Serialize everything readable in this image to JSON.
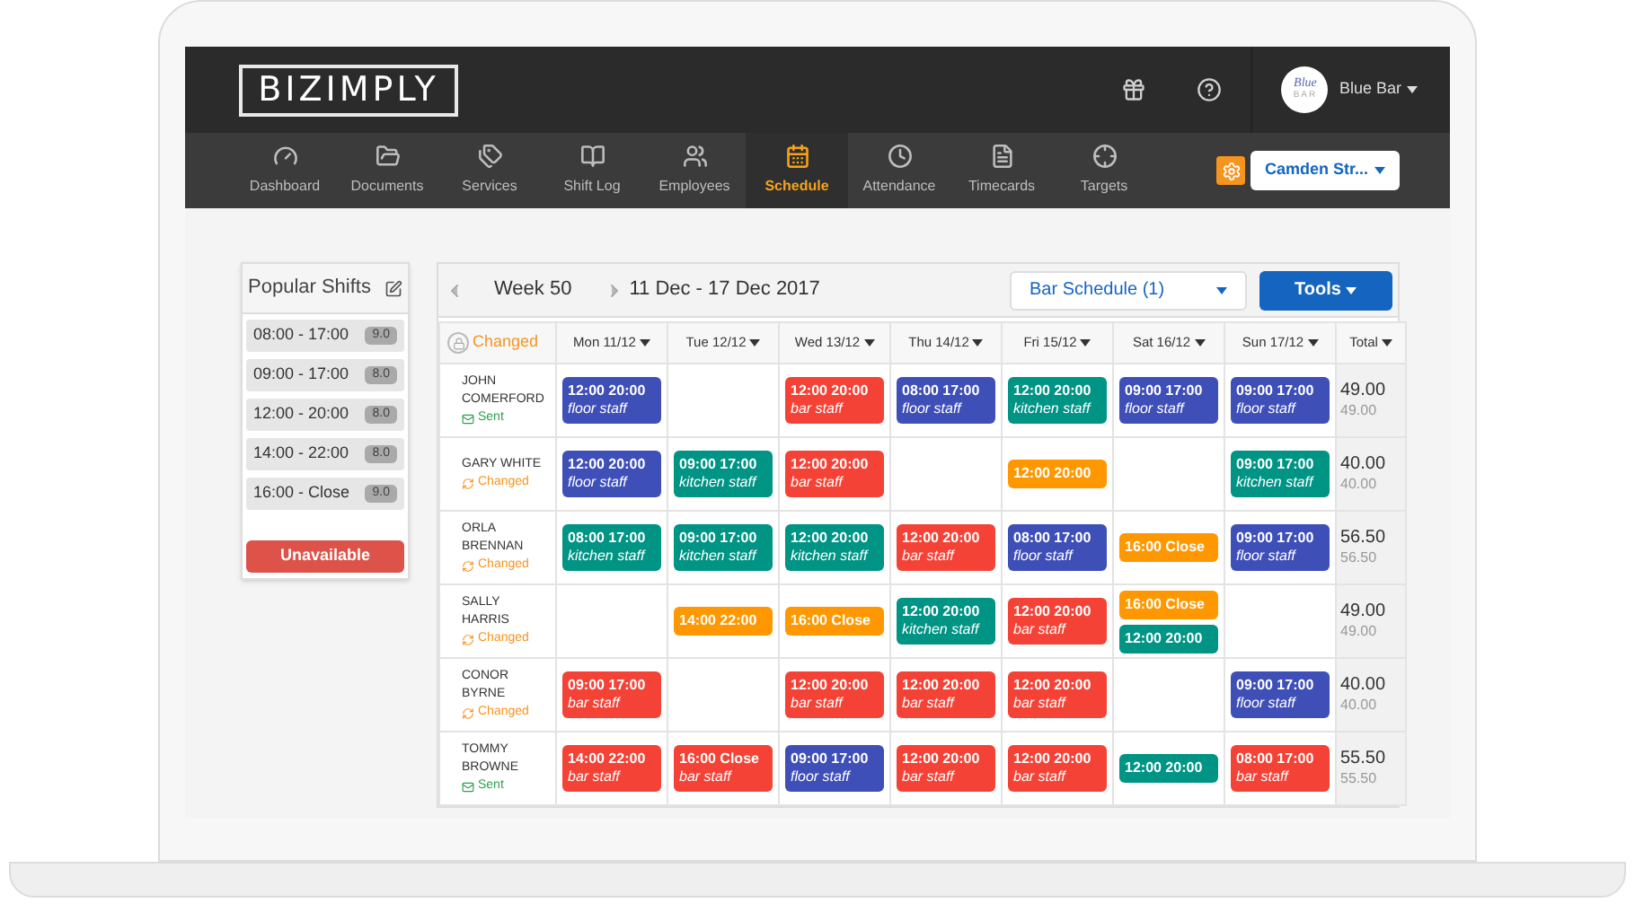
{
  "header": {
    "logo": "BIZIMPLY",
    "avatar_lines": [
      "Blue",
      "BAR"
    ],
    "account": "Blue Bar"
  },
  "nav": [
    {
      "label": "Dashboard",
      "selected": false
    },
    {
      "label": "Documents",
      "selected": false
    },
    {
      "label": "Services",
      "selected": false
    },
    {
      "label": "Shift Log",
      "selected": false
    },
    {
      "label": "Employees",
      "selected": false
    },
    {
      "label": "Schedule",
      "selected": true
    },
    {
      "label": "Attendance",
      "selected": false
    },
    {
      "label": "Timecards",
      "selected": false
    },
    {
      "label": "Targets",
      "selected": false
    }
  ],
  "location": "Camden Str...",
  "popular_shifts": {
    "title": "Popular Shifts",
    "items": [
      {
        "time": "08:00 - 17:00",
        "hours": "9.0"
      },
      {
        "time": "09:00 - 17:00",
        "hours": "8.0"
      },
      {
        "time": "12:00 - 20:00",
        "hours": "8.0"
      },
      {
        "time": "14:00 - 22:00",
        "hours": "8.0"
      },
      {
        "time": "16:00 - Close",
        "hours": "9.0"
      }
    ],
    "unavailable": "Unavailable"
  },
  "toolbar": {
    "week": "Week 50",
    "range": "11 Dec - 17 Dec 2017",
    "schedule": "Bar Schedule (1)",
    "tools": "Tools"
  },
  "table": {
    "status": "Changed",
    "columns": [
      "Mon 11/12",
      "Tue 12/12",
      "Wed 13/12",
      "Thu 14/12",
      "Fri 15/12",
      "Sat 16/12",
      "Sun 17/12",
      "Total"
    ],
    "rows": [
      {
        "name": "JOHN COMERFORD",
        "state": {
          "kind": "sent",
          "text": "Sent"
        },
        "days": [
          {
            "kind": "shifts",
            "shifts": [
              {
                "time": "12:00 20:00",
                "role": "floor staff",
                "color": "#3f4fb8"
              }
            ]
          },
          {
            "kind": "off"
          },
          {
            "kind": "shifts",
            "shifts": [
              {
                "time": "12:00 20:00",
                "role": "bar staff",
                "color": "#f44336"
              }
            ]
          },
          {
            "kind": "shifts",
            "shifts": [
              {
                "time": "08:00 17:00",
                "role": "floor staff",
                "color": "#3f4fb8"
              }
            ]
          },
          {
            "kind": "shifts",
            "shifts": [
              {
                "time": "12:00 20:00",
                "role": "kitchen staff",
                "color": "#009485"
              }
            ]
          },
          {
            "kind": "shifts",
            "shifts": [
              {
                "time": "09:00 17:00",
                "role": "floor staff",
                "color": "#3f4fb8"
              }
            ]
          },
          {
            "kind": "shifts",
            "shifts": [
              {
                "time": "09:00 17:00",
                "role": "floor staff",
                "color": "#3f4fb8"
              }
            ]
          }
        ],
        "total": "49.00",
        "subtotal": "49.00"
      },
      {
        "name": "GARY WHITE",
        "state": {
          "kind": "changed",
          "text": "Changed"
        },
        "days": [
          {
            "kind": "shifts",
            "shifts": [
              {
                "time": "12:00 20:00",
                "role": "floor staff",
                "color": "#3f4fb8"
              }
            ]
          },
          {
            "kind": "shifts",
            "shifts": [
              {
                "time": "09:00 17:00",
                "role": "kitchen staff",
                "color": "#009485"
              }
            ]
          },
          {
            "kind": "shifts",
            "shifts": [
              {
                "time": "12:00 20:00",
                "role": "bar staff",
                "color": "#f44336"
              }
            ]
          },
          {
            "kind": "off"
          },
          {
            "kind": "shifts",
            "shifts": [
              {
                "time": "12:00 20:00",
                "color": "#ff9800"
              }
            ]
          },
          {
            "kind": "off"
          },
          {
            "kind": "shifts",
            "shifts": [
              {
                "time": "09:00 17:00",
                "role": "kitchen staff",
                "color": "#009485"
              }
            ]
          }
        ],
        "total": "40.00",
        "subtotal": "40.00"
      },
      {
        "name": "ORLA BRENNAN",
        "state": {
          "kind": "changed",
          "text": "Changed"
        },
        "days": [
          {
            "kind": "shifts",
            "shifts": [
              {
                "time": "08:00 17:00",
                "role": "kitchen staff",
                "color": "#009485"
              }
            ]
          },
          {
            "kind": "shifts",
            "shifts": [
              {
                "time": "09:00 17:00",
                "role": "kitchen staff",
                "color": "#009485"
              }
            ]
          },
          {
            "kind": "shifts",
            "shifts": [
              {
                "time": "12:00 20:00",
                "role": "kitchen staff",
                "color": "#009485"
              }
            ]
          },
          {
            "kind": "shifts",
            "shifts": [
              {
                "time": "12:00 20:00",
                "role": "bar staff",
                "color": "#f44336"
              }
            ]
          },
          {
            "kind": "shifts",
            "shifts": [
              {
                "time": "08:00 17:00",
                "role": "floor staff",
                "color": "#3f4fb8"
              }
            ]
          },
          {
            "kind": "shifts",
            "shifts": [
              {
                "time": "16:00 Close",
                "color": "#ff9800"
              }
            ]
          },
          {
            "kind": "shifts",
            "shifts": [
              {
                "time": "09:00 17:00",
                "role": "floor staff",
                "color": "#3f4fb8"
              }
            ]
          }
        ],
        "total": "56.50",
        "subtotal": "56.50"
      },
      {
        "name": "SALLY HARRIS",
        "state": {
          "kind": "changed",
          "text": "Changed"
        },
        "days": [
          {
            "kind": "off"
          },
          {
            "kind": "shifts",
            "shifts": [
              {
                "time": "14:00 22:00",
                "color": "#ff9800"
              }
            ]
          },
          {
            "kind": "shifts",
            "shifts": [
              {
                "time": "16:00 Close",
                "color": "#ff9800"
              }
            ]
          },
          {
            "kind": "shifts",
            "shifts": [
              {
                "time": "12:00 20:00",
                "role": "kitchen staff",
                "color": "#009485"
              }
            ]
          },
          {
            "kind": "shifts",
            "shifts": [
              {
                "time": "12:00 20:00",
                "role": "bar staff",
                "color": "#f44336"
              }
            ]
          },
          {
            "kind": "shifts",
            "shifts": [
              {
                "time": "16:00 Close",
                "color": "#ff9800"
              },
              {
                "time": "12:00 20:00",
                "color": "#009485"
              }
            ]
          },
          {
            "kind": "off"
          }
        ],
        "total": "49.00",
        "subtotal": "49.00"
      },
      {
        "name": "CONOR BYRNE",
        "state": {
          "kind": "changed",
          "text": "Changed"
        },
        "days": [
          {
            "kind": "shifts",
            "shifts": [
              {
                "time": "09:00 17:00",
                "role": "bar staff",
                "color": "#f44336"
              }
            ]
          },
          {
            "kind": "off"
          },
          {
            "kind": "shifts",
            "shifts": [
              {
                "time": "12:00 20:00",
                "role": "bar staff",
                "color": "#f44336"
              }
            ]
          },
          {
            "kind": "shifts",
            "shifts": [
              {
                "time": "12:00 20:00",
                "role": "bar staff",
                "color": "#f44336"
              }
            ]
          },
          {
            "kind": "shifts",
            "shifts": [
              {
                "time": "12:00 20:00",
                "role": "bar staff",
                "color": "#f44336"
              }
            ]
          },
          {
            "kind": "off"
          },
          {
            "kind": "shifts",
            "shifts": [
              {
                "time": "09:00 17:00",
                "role": "floor staff",
                "color": "#3f4fb8"
              }
            ]
          }
        ],
        "total": "40.00",
        "subtotal": "40.00"
      },
      {
        "name": "TOMMY BROWNE",
        "state": {
          "kind": "sent",
          "text": "Sent"
        },
        "days": [
          {
            "kind": "shifts",
            "shifts": [
              {
                "time": "14:00 22:00",
                "role": "bar staff",
                "color": "#f44336"
              }
            ]
          },
          {
            "kind": "shifts",
            "shifts": [
              {
                "time": "16:00 Close",
                "role": "bar staff",
                "color": "#f44336"
              }
            ]
          },
          {
            "kind": "shifts",
            "shifts": [
              {
                "time": "09:00 17:00",
                "role": "floor staff",
                "color": "#3f4fb8"
              }
            ]
          },
          {
            "kind": "shifts",
            "shifts": [
              {
                "time": "12:00 20:00",
                "role": "bar staff",
                "color": "#f44336"
              }
            ]
          },
          {
            "kind": "shifts",
            "shifts": [
              {
                "time": "12:00 20:00",
                "role": "bar staff",
                "color": "#f44336"
              }
            ]
          },
          {
            "kind": "shifts",
            "shifts": [
              {
                "time": "12:00 20:00",
                "color": "#009485"
              }
            ]
          },
          {
            "kind": "shifts",
            "shifts": [
              {
                "time": "08:00 17:00",
                "role": "bar staff",
                "color": "#f44336"
              }
            ]
          }
        ],
        "total": "55.50",
        "subtotal": "55.50"
      }
    ]
  }
}
